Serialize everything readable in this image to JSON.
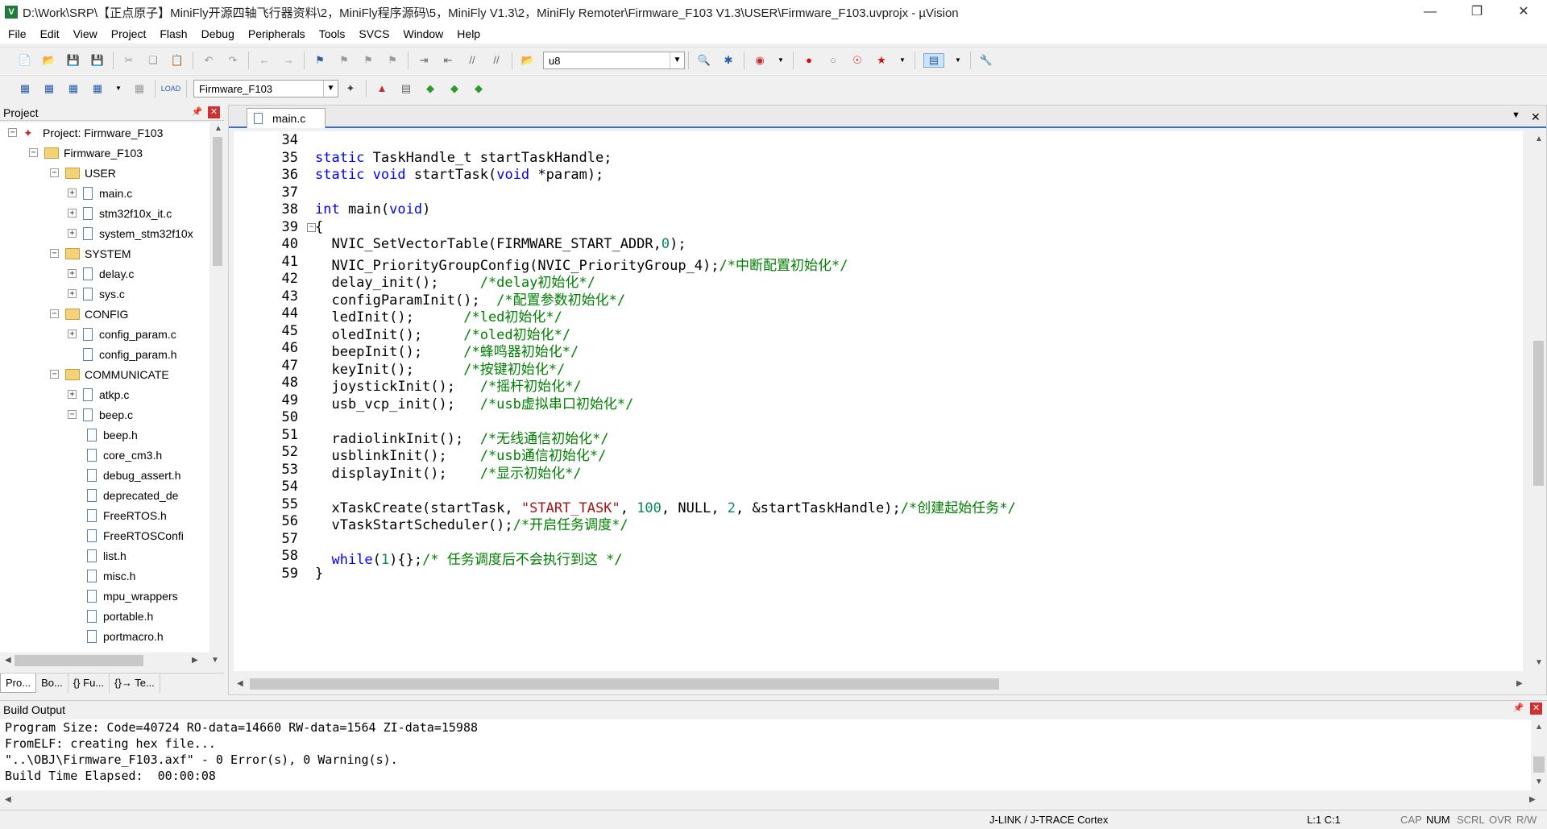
{
  "window": {
    "title": "D:\\Work\\SRP\\【正点原子】MiniFly开源四轴飞行器资料\\2，MiniFly程序源码\\5，MiniFly V1.3\\2，MiniFly Remoter\\Firmware_F103 V1.3\\USER\\Firmware_F103.uvprojx - µVision"
  },
  "menu": [
    "File",
    "Edit",
    "View",
    "Project",
    "Flash",
    "Debug",
    "Peripherals",
    "Tools",
    "SVCS",
    "Window",
    "Help"
  ],
  "toolbar": {
    "find_value": "u8",
    "target_value": "Firmware_F103"
  },
  "project_panel": {
    "title": "Project",
    "tree": [
      {
        "label": "Project: Firmware_F103",
        "type": "project",
        "level": 0,
        "expander": "−"
      },
      {
        "label": "Firmware_F103",
        "type": "target",
        "level": 1,
        "expander": "−"
      },
      {
        "label": "USER",
        "type": "folder",
        "level": 2,
        "expander": "−"
      },
      {
        "label": "main.c",
        "type": "file",
        "level": 3,
        "expander": "+"
      },
      {
        "label": "stm32f10x_it.c",
        "type": "file",
        "level": 3,
        "expander": "+"
      },
      {
        "label": "system_stm32f10x",
        "type": "file",
        "level": 3,
        "expander": "+"
      },
      {
        "label": "SYSTEM",
        "type": "folder",
        "level": 2,
        "expander": "−"
      },
      {
        "label": "delay.c",
        "type": "file",
        "level": 3,
        "expander": "+"
      },
      {
        "label": "sys.c",
        "type": "file",
        "level": 3,
        "expander": "+"
      },
      {
        "label": "CONFIG",
        "type": "folder",
        "level": 2,
        "expander": "−"
      },
      {
        "label": "config_param.c",
        "type": "file",
        "level": 3,
        "expander": "+"
      },
      {
        "label": "config_param.h",
        "type": "file",
        "level": 3,
        "expander": ""
      },
      {
        "label": "COMMUNICATE",
        "type": "folder",
        "level": 2,
        "expander": "−"
      },
      {
        "label": "atkp.c",
        "type": "file",
        "level": 3,
        "expander": "+"
      },
      {
        "label": "beep.c",
        "type": "file",
        "level": 3,
        "expander": "−"
      },
      {
        "label": "beep.h",
        "type": "file",
        "level": 4,
        "expander": ""
      },
      {
        "label": "core_cm3.h",
        "type": "file",
        "level": 4,
        "expander": ""
      },
      {
        "label": "debug_assert.h",
        "type": "file",
        "level": 4,
        "expander": ""
      },
      {
        "label": "deprecated_de",
        "type": "file",
        "level": 4,
        "expander": ""
      },
      {
        "label": "FreeRTOS.h",
        "type": "file",
        "level": 4,
        "expander": ""
      },
      {
        "label": "FreeRTOSConfi",
        "type": "file",
        "level": 4,
        "expander": ""
      },
      {
        "label": "list.h",
        "type": "file",
        "level": 4,
        "expander": ""
      },
      {
        "label": "misc.h",
        "type": "file",
        "level": 4,
        "expander": ""
      },
      {
        "label": "mpu_wrappers",
        "type": "file",
        "level": 4,
        "expander": ""
      },
      {
        "label": "portable.h",
        "type": "file",
        "level": 4,
        "expander": ""
      },
      {
        "label": "portmacro.h",
        "type": "file",
        "level": 4,
        "expander": ""
      }
    ],
    "tabs": [
      "Pro...",
      "Bo...",
      "{} Fu...",
      "{}→ Te..."
    ]
  },
  "editor": {
    "tab_label": "main.c",
    "lines": [
      {
        "n": "34",
        "tokens": []
      },
      {
        "n": "35",
        "tokens": [
          {
            "t": "static",
            "c": "kw"
          },
          {
            "t": " TaskHandle_t startTaskHandle;",
            "c": ""
          }
        ]
      },
      {
        "n": "36",
        "tokens": [
          {
            "t": "static",
            "c": "kw"
          },
          {
            "t": " ",
            "c": ""
          },
          {
            "t": "void",
            "c": "kw"
          },
          {
            "t": " startTask(",
            "c": ""
          },
          {
            "t": "void",
            "c": "kw"
          },
          {
            "t": " *param);",
            "c": ""
          }
        ]
      },
      {
        "n": "37",
        "tokens": []
      },
      {
        "n": "38",
        "tokens": [
          {
            "t": "int",
            "c": "kw"
          },
          {
            "t": " main(",
            "c": ""
          },
          {
            "t": "void",
            "c": "kw"
          },
          {
            "t": ")",
            "c": ""
          }
        ]
      },
      {
        "n": "39",
        "tokens": [
          {
            "t": "{",
            "c": ""
          }
        ],
        "fold": true
      },
      {
        "n": "40",
        "tokens": [
          {
            "t": "  NVIC_SetVectorTable(FIRMWARE_START_ADDR,",
            "c": ""
          },
          {
            "t": "0",
            "c": "nm"
          },
          {
            "t": ");",
            "c": ""
          }
        ]
      },
      {
        "n": "41",
        "tokens": [
          {
            "t": "  NVIC_PriorityGroupConfig(NVIC_PriorityGroup_4);",
            "c": ""
          },
          {
            "t": "/*中断配置初始化*/",
            "c": "cm"
          }
        ]
      },
      {
        "n": "42",
        "tokens": [
          {
            "t": "  delay_init();     ",
            "c": ""
          },
          {
            "t": "/*delay初始化*/",
            "c": "cm"
          }
        ]
      },
      {
        "n": "43",
        "tokens": [
          {
            "t": "  configParamInit();  ",
            "c": ""
          },
          {
            "t": "/*配置参数初始化*/",
            "c": "cm"
          }
        ]
      },
      {
        "n": "44",
        "tokens": [
          {
            "t": "  ledInit();      ",
            "c": ""
          },
          {
            "t": "/*led初始化*/",
            "c": "cm"
          }
        ]
      },
      {
        "n": "45",
        "tokens": [
          {
            "t": "  oledInit();     ",
            "c": ""
          },
          {
            "t": "/*oled初始化*/",
            "c": "cm"
          }
        ]
      },
      {
        "n": "46",
        "tokens": [
          {
            "t": "  beepInit();     ",
            "c": ""
          },
          {
            "t": "/*蜂鸣器初始化*/",
            "c": "cm"
          }
        ]
      },
      {
        "n": "47",
        "tokens": [
          {
            "t": "  keyInit();      ",
            "c": ""
          },
          {
            "t": "/*按键初始化*/",
            "c": "cm"
          }
        ]
      },
      {
        "n": "48",
        "tokens": [
          {
            "t": "  joystickInit();   ",
            "c": ""
          },
          {
            "t": "/*摇杆初始化*/",
            "c": "cm"
          }
        ]
      },
      {
        "n": "49",
        "tokens": [
          {
            "t": "  usb_vcp_init();   ",
            "c": ""
          },
          {
            "t": "/*usb虚拟串口初始化*/",
            "c": "cm"
          }
        ]
      },
      {
        "n": "50",
        "tokens": []
      },
      {
        "n": "51",
        "tokens": [
          {
            "t": "  radiolinkInit();  ",
            "c": ""
          },
          {
            "t": "/*无线通信初始化*/",
            "c": "cm"
          }
        ]
      },
      {
        "n": "52",
        "tokens": [
          {
            "t": "  usblinkInit();    ",
            "c": ""
          },
          {
            "t": "/*usb通信初始化*/",
            "c": "cm"
          }
        ]
      },
      {
        "n": "53",
        "tokens": [
          {
            "t": "  displayInit();    ",
            "c": ""
          },
          {
            "t": "/*显示初始化*/",
            "c": "cm"
          }
        ]
      },
      {
        "n": "54",
        "tokens": []
      },
      {
        "n": "55",
        "tokens": [
          {
            "t": "  xTaskCreate(startTask, ",
            "c": ""
          },
          {
            "t": "\"START_TASK\"",
            "c": "st"
          },
          {
            "t": ", ",
            "c": ""
          },
          {
            "t": "100",
            "c": "nm"
          },
          {
            "t": ", NULL, ",
            "c": ""
          },
          {
            "t": "2",
            "c": "nm"
          },
          {
            "t": ", &startTaskHandle);",
            "c": ""
          },
          {
            "t": "/*创建起始任务*/",
            "c": "cm"
          }
        ]
      },
      {
        "n": "56",
        "tokens": [
          {
            "t": "  vTaskStartScheduler();",
            "c": ""
          },
          {
            "t": "/*开启任务调度*/",
            "c": "cm"
          }
        ]
      },
      {
        "n": "57",
        "tokens": []
      },
      {
        "n": "58",
        "tokens": [
          {
            "t": "  ",
            "c": ""
          },
          {
            "t": "while",
            "c": "kw"
          },
          {
            "t": "(",
            "c": ""
          },
          {
            "t": "1",
            "c": "nm"
          },
          {
            "t": "){};",
            "c": ""
          },
          {
            "t": "/* 任务调度后不会执行到这 */",
            "c": "cm"
          }
        ]
      },
      {
        "n": "59",
        "tokens": [
          {
            "t": "}",
            "c": ""
          }
        ]
      }
    ]
  },
  "build_output": {
    "title": "Build Output",
    "lines": [
      "Program Size: Code=40724 RO-data=14660 RW-data=1564 ZI-data=15988",
      "FromELF: creating hex file...",
      "\"..\\OBJ\\Firmware_F103.axf\" - 0 Error(s), 0 Warning(s).",
      "Build Time Elapsed:  00:00:08"
    ]
  },
  "status": {
    "debugger": "J-LINK / J-TRACE Cortex",
    "position": "L:1 C:1",
    "cap": "CAP",
    "num": "NUM",
    "scrl": "SCRL",
    "ovr": "OVR",
    "rw": "R/W"
  }
}
